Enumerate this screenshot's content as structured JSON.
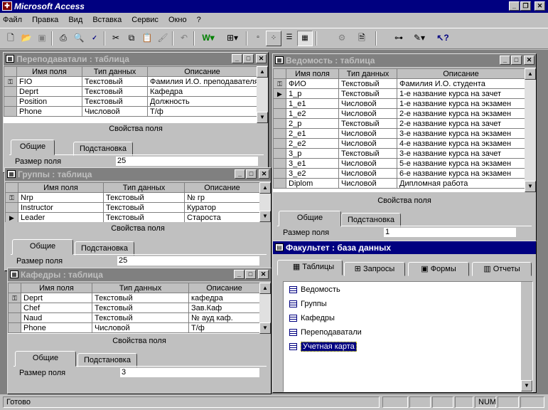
{
  "app": {
    "title": "Microsoft Access",
    "icon": "access-key-icon"
  },
  "menu": [
    "Файл",
    "Правка",
    "Вид",
    "Вставка",
    "Сервис",
    "Окно",
    "?"
  ],
  "toolbar": {
    "icons": [
      "new-icon",
      "open-icon",
      "save-icon",
      "print-icon",
      "preview-icon",
      "spell-icon",
      "cut-icon",
      "copy-icon",
      "paste-icon",
      "format-painter-icon",
      "undo-icon",
      "office-links-icon",
      "analyze-icon",
      "large-icons-icon",
      "small-icons-icon",
      "list-icon",
      "details-icon",
      "code-icon",
      "properties-icon",
      "relationships-icon",
      "new-object-icon",
      "help-icon"
    ]
  },
  "columns": {
    "name": "Имя поля",
    "type": "Тип данных",
    "desc": "Описание"
  },
  "props": {
    "title": "Свойства поля",
    "tab_general": "Общие",
    "tab_lookup": "Подстановка",
    "size_label": "Размер поля"
  },
  "teachers": {
    "title": "Переподаватали : таблица",
    "size_value": "25",
    "rows": [
      {
        "key": true,
        "name": "FIO",
        "type": "Текстовый",
        "desc": "Фамилия И.О. преподавателя"
      },
      {
        "key": false,
        "name": "Deprt",
        "type": "Текстовый",
        "desc": "Кафедра"
      },
      {
        "key": false,
        "name": "Position",
        "type": "Текстовый",
        "desc": "Должность"
      },
      {
        "key": false,
        "name": "Phone",
        "type": "Числовой",
        "desc": "Т/ф"
      }
    ]
  },
  "groups": {
    "title": "Группы : таблица",
    "size_value": "25",
    "rows": [
      {
        "key": true,
        "name": "Nrp",
        "type": "Текстовый",
        "desc": "№ гр"
      },
      {
        "key": false,
        "name": "Instructor",
        "type": "Текстовый",
        "desc": "Куратор"
      },
      {
        "key": false,
        "name": "Leader",
        "type": "Текстовый",
        "desc": "Староста"
      }
    ]
  },
  "departments": {
    "title": "Кафедры : таблица",
    "size_value": "3",
    "rows": [
      {
        "key": true,
        "name": "Deprt",
        "type": "Текстовый",
        "desc": "кафедра"
      },
      {
        "key": false,
        "name": "Chef",
        "type": "Текстовый",
        "desc": "Зав.Каф"
      },
      {
        "key": false,
        "name": "Naud",
        "type": "Текстовый",
        "desc": "№ ауд каф."
      },
      {
        "key": false,
        "name": "Phone",
        "type": "Числовой",
        "desc": "Т/ф"
      }
    ]
  },
  "gradebook": {
    "title": "Ведомость : таблица",
    "size_value": "1",
    "rows": [
      {
        "key": true,
        "name": "ФИО",
        "type": "Текстовый",
        "desc": "Фамилия И.О. студента"
      },
      {
        "key": false,
        "name": "1_p",
        "type": "Текстовый",
        "desc": "1-е название курса на зачет"
      },
      {
        "key": false,
        "name": "1_e1",
        "type": "Числовой",
        "desc": "1-е название курса на экзамен"
      },
      {
        "key": false,
        "name": "1_e2",
        "type": "Числовой",
        "desc": "2-е название курса на экзамен"
      },
      {
        "key": false,
        "name": "2_p",
        "type": "Текстовый",
        "desc": "2-е название курса на зачет"
      },
      {
        "key": false,
        "name": "2_e1",
        "type": "Числовой",
        "desc": "3-е название курса на экзамен"
      },
      {
        "key": false,
        "name": "2_e2",
        "type": "Числовой",
        "desc": "4-е название курса на экзамен"
      },
      {
        "key": false,
        "name": "3_p",
        "type": "Текстовый",
        "desc": "3-е название курса на зачет"
      },
      {
        "key": false,
        "name": "3_e1",
        "type": "Числовой",
        "desc": "5-е название курса на экзамен"
      },
      {
        "key": false,
        "name": "3_e2",
        "type": "Числовой",
        "desc": "6-е название курса на экзамен"
      },
      {
        "key": false,
        "name": "Diplom",
        "type": "Числовой",
        "desc": "Дипломная работа"
      }
    ]
  },
  "database": {
    "title": "Факультет : база данных",
    "tabs": [
      "Таблицы",
      "Запросы",
      "Формы",
      "Отчеты"
    ],
    "items": [
      "Ведомость",
      "Группы",
      "Кафедры",
      "Переподаватали",
      "Учетная карта"
    ],
    "selected_index": 4
  },
  "status": {
    "text": "Готово",
    "num": "NUM"
  }
}
